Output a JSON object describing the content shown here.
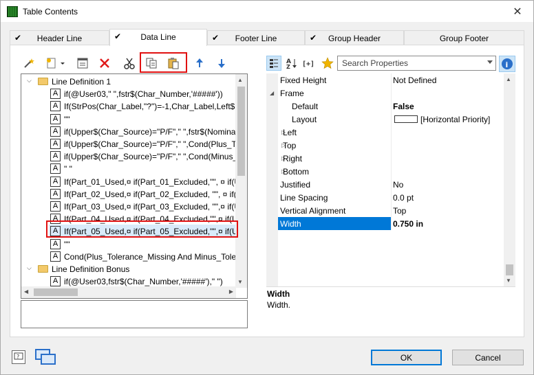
{
  "window": {
    "title": "Table Contents",
    "close_glyph": "✕"
  },
  "tabs": [
    {
      "label": "Header Line",
      "checked": true
    },
    {
      "label": "Data Line",
      "checked": true,
      "active": true
    },
    {
      "label": "Footer Line",
      "checked": true
    },
    {
      "label": "Group Header",
      "checked": true
    },
    {
      "label": "Group Footer",
      "checked": false
    }
  ],
  "check_glyph": "✔",
  "toolbar": {
    "icons": [
      "wand-icon",
      "new-item-icon",
      "properties-icon",
      "delete-icon",
      "cut-icon",
      "copy-icon",
      "paste-icon",
      "move-up-icon",
      "move-down-icon"
    ]
  },
  "tree": {
    "rows": [
      {
        "type": "folder",
        "text": "Line Definition  1",
        "expanded": true
      },
      {
        "type": "item",
        "text": "if(@User03,\" \",fstr$(Char_Number,'#####'))"
      },
      {
        "type": "item",
        "text": "If(StrPos(Char_Label,\"?\")=-1,Char_Label,Left$(C"
      },
      {
        "type": "item",
        "text": "\"\""
      },
      {
        "type": "item",
        "text": "if(Upper$(Char_Source)=\"P/F\",\" \",fstr$(Nomina"
      },
      {
        "type": "item",
        "text": "if(Upper$(Char_Source)=\"P/F\",\" \",Cond(Plus_To"
      },
      {
        "type": "item",
        "text": "if(Upper$(Char_Source)=\"P/F\",\" \",Cond(Minus_"
      },
      {
        "type": "item",
        "text": "\" \""
      },
      {
        "type": "item",
        "text": "If(Part_01_Used,¤ if(Part_01_Excluded,\"\", ¤  if(Up"
      },
      {
        "type": "item",
        "text": "If(Part_02_Used,¤ if(Part_02_Excluded, \"\", ¤  if(U"
      },
      {
        "type": "item",
        "text": "If(Part_03_Used,¤ if(Part_03_Excluded, \"\",¤  if(U"
      },
      {
        "type": "item",
        "text": "If(Part_04_Used,¤ if(Part_04_Excluded,\"\",¤  if(Up"
      },
      {
        "type": "item",
        "text": "If(Part_05_Used,¤ if(Part_05_Excluded,\"\",¤  if(Up",
        "selected": true
      },
      {
        "type": "item",
        "text": "\"\""
      },
      {
        "type": "item",
        "text": "Cond(Plus_Tolerance_Missing And Minus_Toler"
      },
      {
        "type": "folder",
        "text": "Line Definition Bonus",
        "expanded": true
      },
      {
        "type": "item",
        "text": "if(@User03,fstr$(Char_Number,'#####'),\" \")"
      }
    ]
  },
  "search": {
    "placeholder": "Search Properties"
  },
  "properties": {
    "rows": [
      {
        "key": "Fixed Height",
        "value": "Not Defined",
        "level": 0
      },
      {
        "key": "Frame",
        "value": "",
        "level": 0,
        "expander": "◢"
      },
      {
        "key": "Default",
        "value": "False",
        "level": 2,
        "bold": true
      },
      {
        "key": "Layout",
        "value": "[Horizontal Priority]",
        "level": 2,
        "swatch": true
      },
      {
        "key": "Left",
        "value": "",
        "level": 1,
        "expander": "▷"
      },
      {
        "key": "Top",
        "value": "",
        "level": 1,
        "expander": "▷"
      },
      {
        "key": "Right",
        "value": "",
        "level": 1,
        "expander": "▷"
      },
      {
        "key": "Bottom",
        "value": "",
        "level": 1,
        "expander": "▷"
      },
      {
        "key": "Justified",
        "value": "No",
        "level": 0
      },
      {
        "key": "Line Spacing",
        "value": "0.0 pt",
        "level": 0
      },
      {
        "key": "Vertical Alignment",
        "value": "Top",
        "level": 0
      },
      {
        "key": "Width",
        "value": "0.750 in",
        "level": 0,
        "selected": true,
        "bold": true
      }
    ]
  },
  "description": {
    "title": "Width",
    "text": "Width."
  },
  "buttons": {
    "ok": "OK",
    "cancel": "Cancel"
  },
  "colors": {
    "accent": "#0078d7",
    "highlight": "#e01010"
  }
}
